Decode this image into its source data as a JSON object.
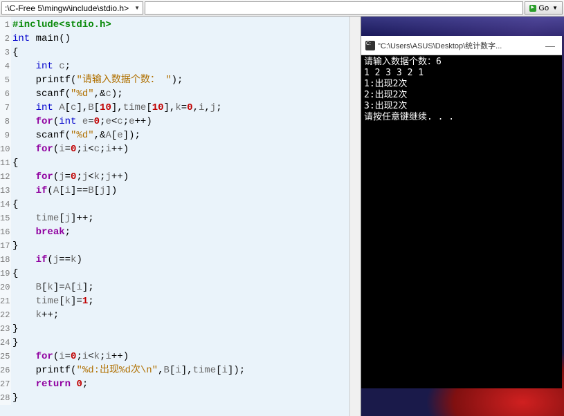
{
  "toolbar": {
    "path": ":\\C-Free 5\\mingw\\include\\stdio.h>",
    "search_value": "",
    "go_label": "Go"
  },
  "code": {
    "lines": [
      {
        "n": "1",
        "t": [
          [
            "k-pre",
            "#include<stdio.h>"
          ]
        ]
      },
      {
        "n": "2",
        "t": [
          [
            "k-type",
            "int"
          ],
          [
            "k-op",
            " "
          ],
          [
            "k-fn",
            "main"
          ],
          [
            "k-pun",
            "()"
          ]
        ]
      },
      {
        "n": "3",
        "t": [
          [
            "k-pun",
            "{"
          ]
        ]
      },
      {
        "n": "4",
        "t": [
          [
            "k-op",
            "    "
          ],
          [
            "k-type",
            "int"
          ],
          [
            "k-op",
            " "
          ],
          [
            "k-var",
            "c"
          ],
          [
            "k-pun",
            ";"
          ]
        ]
      },
      {
        "n": "5",
        "t": [
          [
            "k-op",
            "    "
          ],
          [
            "k-fn",
            "printf"
          ],
          [
            "k-pun",
            "("
          ],
          [
            "k-str",
            "\"请输入数据个数："
          ],
          [
            "k-op",
            " "
          ],
          [
            "k-str",
            "\""
          ],
          [
            "k-pun",
            ");"
          ]
        ]
      },
      {
        "n": "6",
        "t": [
          [
            "k-op",
            "    "
          ],
          [
            "k-fn",
            "scanf"
          ],
          [
            "k-pun",
            "("
          ],
          [
            "k-str",
            "\"%d\""
          ],
          [
            "k-pun",
            ",&"
          ],
          [
            "k-var",
            "c"
          ],
          [
            "k-pun",
            ");"
          ]
        ]
      },
      {
        "n": "7",
        "t": [
          [
            "k-op",
            "    "
          ],
          [
            "k-type",
            "int"
          ],
          [
            "k-op",
            " "
          ],
          [
            "k-var",
            "A"
          ],
          [
            "k-pun",
            "["
          ],
          [
            "k-var",
            "c"
          ],
          [
            "k-pun",
            "],"
          ],
          [
            "k-var",
            "B"
          ],
          [
            "k-pun",
            "["
          ],
          [
            "k-num",
            "10"
          ],
          [
            "k-pun",
            "],"
          ],
          [
            "k-var",
            "time"
          ],
          [
            "k-pun",
            "["
          ],
          [
            "k-num",
            "10"
          ],
          [
            "k-pun",
            "],"
          ],
          [
            "k-var",
            "k"
          ],
          [
            "k-pun",
            "="
          ],
          [
            "k-num",
            "0"
          ],
          [
            "k-pun",
            ","
          ],
          [
            "k-var",
            "i"
          ],
          [
            "k-pun",
            ","
          ],
          [
            "k-var",
            "j"
          ],
          [
            "k-pun",
            ";"
          ]
        ]
      },
      {
        "n": "8",
        "t": [
          [
            "k-op",
            "    "
          ],
          [
            "k-kw",
            "for"
          ],
          [
            "k-pun",
            "("
          ],
          [
            "k-type",
            "int"
          ],
          [
            "k-op",
            " "
          ],
          [
            "k-var",
            "e"
          ],
          [
            "k-pun",
            "="
          ],
          [
            "k-num",
            "0"
          ],
          [
            "k-pun",
            ";"
          ],
          [
            "k-var",
            "e"
          ],
          [
            "k-pun",
            "<"
          ],
          [
            "k-var",
            "c"
          ],
          [
            "k-pun",
            ";"
          ],
          [
            "k-var",
            "e"
          ],
          [
            "k-pun",
            "++)"
          ]
        ]
      },
      {
        "n": "9",
        "t": [
          [
            "k-op",
            "    "
          ],
          [
            "k-fn",
            "scanf"
          ],
          [
            "k-pun",
            "("
          ],
          [
            "k-str",
            "\"%d\""
          ],
          [
            "k-pun",
            ",&"
          ],
          [
            "k-var",
            "A"
          ],
          [
            "k-pun",
            "["
          ],
          [
            "k-var",
            "e"
          ],
          [
            "k-pun",
            "]);"
          ]
        ]
      },
      {
        "n": "10",
        "t": [
          [
            "k-op",
            "    "
          ],
          [
            "k-kw",
            "for"
          ],
          [
            "k-pun",
            "("
          ],
          [
            "k-var",
            "i"
          ],
          [
            "k-pun",
            "="
          ],
          [
            "k-num",
            "0"
          ],
          [
            "k-pun",
            ";"
          ],
          [
            "k-var",
            "i"
          ],
          [
            "k-pun",
            "<"
          ],
          [
            "k-var",
            "c"
          ],
          [
            "k-pun",
            ";"
          ],
          [
            "k-var",
            "i"
          ],
          [
            "k-pun",
            "++)"
          ]
        ]
      },
      {
        "n": "11",
        "t": [
          [
            "k-pun",
            "{"
          ]
        ]
      },
      {
        "n": "12",
        "t": [
          [
            "k-op",
            "    "
          ],
          [
            "k-kw",
            "for"
          ],
          [
            "k-pun",
            "("
          ],
          [
            "k-var",
            "j"
          ],
          [
            "k-pun",
            "="
          ],
          [
            "k-num",
            "0"
          ],
          [
            "k-pun",
            ";"
          ],
          [
            "k-var",
            "j"
          ],
          [
            "k-pun",
            "<"
          ],
          [
            "k-var",
            "k"
          ],
          [
            "k-pun",
            ";"
          ],
          [
            "k-var",
            "j"
          ],
          [
            "k-pun",
            "++)"
          ]
        ]
      },
      {
        "n": "13",
        "t": [
          [
            "k-op",
            "    "
          ],
          [
            "k-kw",
            "if"
          ],
          [
            "k-pun",
            "("
          ],
          [
            "k-var",
            "A"
          ],
          [
            "k-pun",
            "["
          ],
          [
            "k-var",
            "i"
          ],
          [
            "k-pun",
            "]=="
          ],
          [
            "k-var",
            "B"
          ],
          [
            "k-pun",
            "["
          ],
          [
            "k-var",
            "j"
          ],
          [
            "k-pun",
            "])"
          ]
        ]
      },
      {
        "n": "14",
        "t": [
          [
            "k-pun",
            "{"
          ]
        ]
      },
      {
        "n": "15",
        "t": [
          [
            "k-op",
            "    "
          ],
          [
            "k-var",
            "time"
          ],
          [
            "k-pun",
            "["
          ],
          [
            "k-var",
            "j"
          ],
          [
            "k-pun",
            "]++;"
          ]
        ]
      },
      {
        "n": "16",
        "t": [
          [
            "k-op",
            "    "
          ],
          [
            "k-kw",
            "break"
          ],
          [
            "k-pun",
            ";"
          ]
        ]
      },
      {
        "n": "17",
        "t": [
          [
            "k-pun",
            "}"
          ]
        ]
      },
      {
        "n": "18",
        "t": [
          [
            "k-op",
            "    "
          ],
          [
            "k-kw",
            "if"
          ],
          [
            "k-pun",
            "("
          ],
          [
            "k-var",
            "j"
          ],
          [
            "k-pun",
            "=="
          ],
          [
            "k-var",
            "k"
          ],
          [
            "k-pun",
            ")"
          ]
        ]
      },
      {
        "n": "19",
        "t": [
          [
            "k-pun",
            "{"
          ]
        ]
      },
      {
        "n": "20",
        "t": [
          [
            "k-op",
            "    "
          ],
          [
            "k-var",
            "B"
          ],
          [
            "k-pun",
            "["
          ],
          [
            "k-var",
            "k"
          ],
          [
            "k-pun",
            "]="
          ],
          [
            "k-var",
            "A"
          ],
          [
            "k-pun",
            "["
          ],
          [
            "k-var",
            "i"
          ],
          [
            "k-pun",
            "];"
          ]
        ]
      },
      {
        "n": "21",
        "t": [
          [
            "k-op",
            "    "
          ],
          [
            "k-var",
            "time"
          ],
          [
            "k-pun",
            "["
          ],
          [
            "k-var",
            "k"
          ],
          [
            "k-pun",
            "]="
          ],
          [
            "k-num",
            "1"
          ],
          [
            "k-pun",
            ";"
          ]
        ]
      },
      {
        "n": "22",
        "t": [
          [
            "k-op",
            "    "
          ],
          [
            "k-var",
            "k"
          ],
          [
            "k-pun",
            "++;"
          ]
        ]
      },
      {
        "n": "23",
        "t": [
          [
            "k-pun",
            "}"
          ]
        ]
      },
      {
        "n": "24",
        "t": [
          [
            "k-pun",
            "}"
          ]
        ]
      },
      {
        "n": "25",
        "t": [
          [
            "k-op",
            "    "
          ],
          [
            "k-kw",
            "for"
          ],
          [
            "k-pun",
            "("
          ],
          [
            "k-var",
            "i"
          ],
          [
            "k-pun",
            "="
          ],
          [
            "k-num",
            "0"
          ],
          [
            "k-pun",
            ";"
          ],
          [
            "k-var",
            "i"
          ],
          [
            "k-pun",
            "<"
          ],
          [
            "k-var",
            "k"
          ],
          [
            "k-pun",
            ";"
          ],
          [
            "k-var",
            "i"
          ],
          [
            "k-pun",
            "++)"
          ]
        ]
      },
      {
        "n": "26",
        "t": [
          [
            "k-op",
            "    "
          ],
          [
            "k-fn",
            "printf"
          ],
          [
            "k-pun",
            "("
          ],
          [
            "k-str",
            "\"%d:出现%d次\\n\""
          ],
          [
            "k-pun",
            ","
          ],
          [
            "k-var",
            "B"
          ],
          [
            "k-pun",
            "["
          ],
          [
            "k-var",
            "i"
          ],
          [
            "k-pun",
            "],"
          ],
          [
            "k-var",
            "time"
          ],
          [
            "k-pun",
            "["
          ],
          [
            "k-var",
            "i"
          ],
          [
            "k-pun",
            "]);"
          ]
        ]
      },
      {
        "n": "27",
        "t": [
          [
            "k-op",
            "    "
          ],
          [
            "k-kw",
            "return"
          ],
          [
            "k-op",
            " "
          ],
          [
            "k-num",
            "0"
          ],
          [
            "k-pun",
            ";"
          ]
        ]
      },
      {
        "n": "28",
        "t": [
          [
            "k-pun",
            "}"
          ]
        ]
      }
    ]
  },
  "console": {
    "title": "\"C:\\Users\\ASUS\\Desktop\\统计数字...",
    "lines": [
      "请输入数据个数：6",
      "1 2 3 3 2 1",
      "1:出现2次",
      "2:出现2次",
      "3:出现2次",
      "请按任意键继续. . ."
    ]
  }
}
